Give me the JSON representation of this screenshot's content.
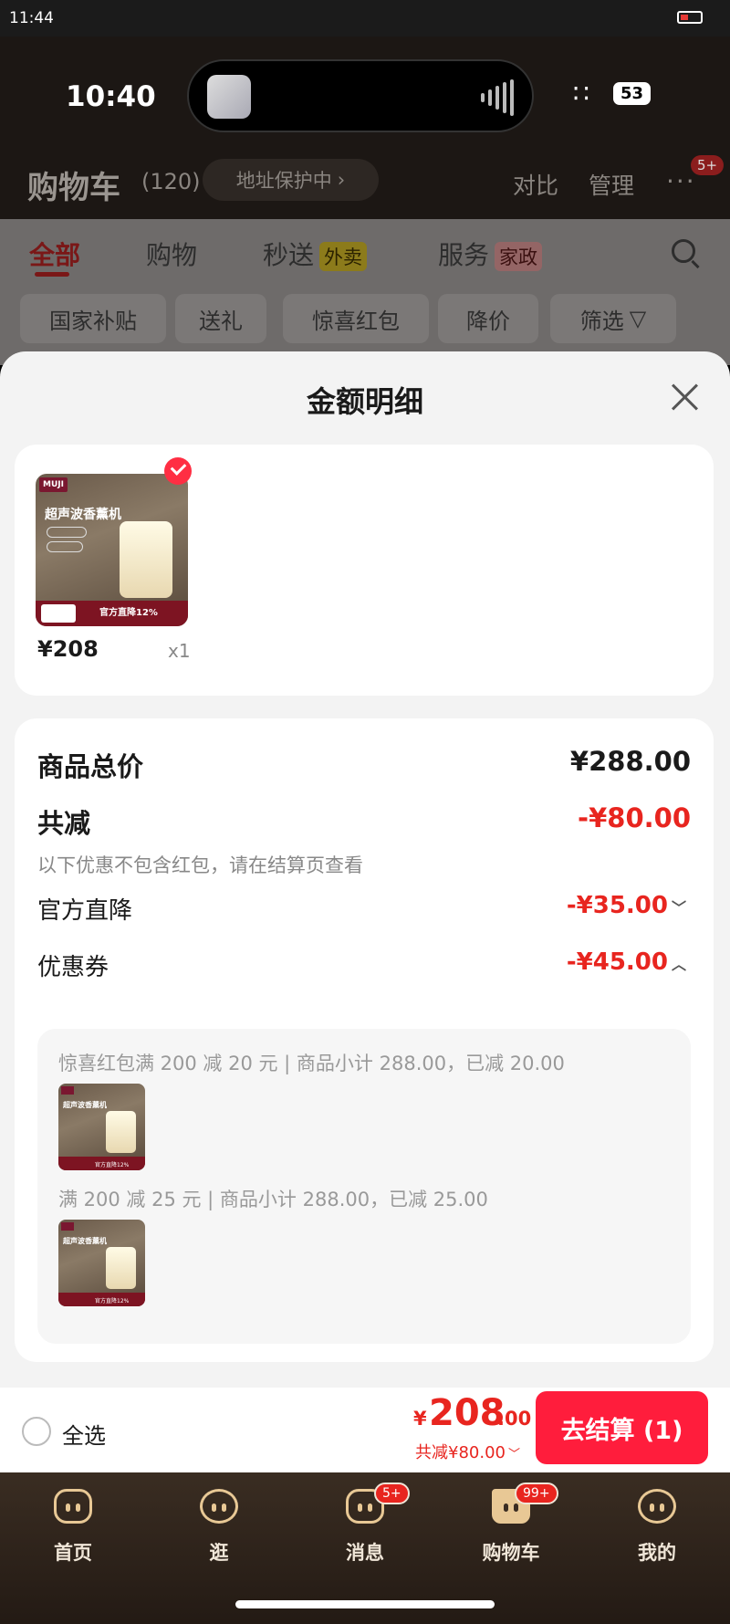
{
  "outer_status": {
    "time": "11:44"
  },
  "inner_status": {
    "time": "10:40",
    "battery": "53"
  },
  "header": {
    "title": "购物车",
    "count": "(120)",
    "address_pill": "地址保护中",
    "compare": "对比",
    "manage": "管理",
    "more_badge": "5+"
  },
  "tabs": [
    {
      "label": "全部"
    },
    {
      "label": "购物"
    },
    {
      "label": "秒送",
      "tag": "外卖"
    },
    {
      "label": "服务",
      "tag": "家政"
    }
  ],
  "chips": [
    "国家补贴",
    "送礼",
    "惊喜红包",
    "降价",
    "筛选"
  ],
  "sheet": {
    "title": "金额明细",
    "product": {
      "brand": "MUJI",
      "image_title": "超声波香薰机",
      "image_banner": "官方直降12%",
      "price": "¥208",
      "qty": "x1"
    },
    "total_label": "商品总价",
    "total_value": "¥288.00",
    "reduce_label": "共减",
    "reduce_value": "-¥80.00",
    "note": "以下优惠不包含红包，请在结算页查看",
    "official_label": "官方直降",
    "official_value": "-¥35.00",
    "coupon_label": "优惠券",
    "coupon_value": "-¥45.00",
    "coupons": [
      "惊喜红包满 200 减 20 元 | 商品小计 288.00，已减 20.00",
      "满 200 减 25 元 | 商品小计 288.00，已减 25.00"
    ]
  },
  "checkout": {
    "select_all": "全选",
    "yen": "¥",
    "amount": "208",
    "decimal": ".00",
    "discount": "共减¥80.00",
    "button": "去结算 (1)"
  },
  "nav": [
    {
      "label": "首页"
    },
    {
      "label": "逛"
    },
    {
      "label": "消息",
      "badge": "5+"
    },
    {
      "label": "购物车",
      "badge": "99+"
    },
    {
      "label": "我的"
    }
  ],
  "colors": {
    "accent_red": "#e8251f",
    "button_red": "#ff1d3c",
    "nav_gold": "#e8c895"
  }
}
